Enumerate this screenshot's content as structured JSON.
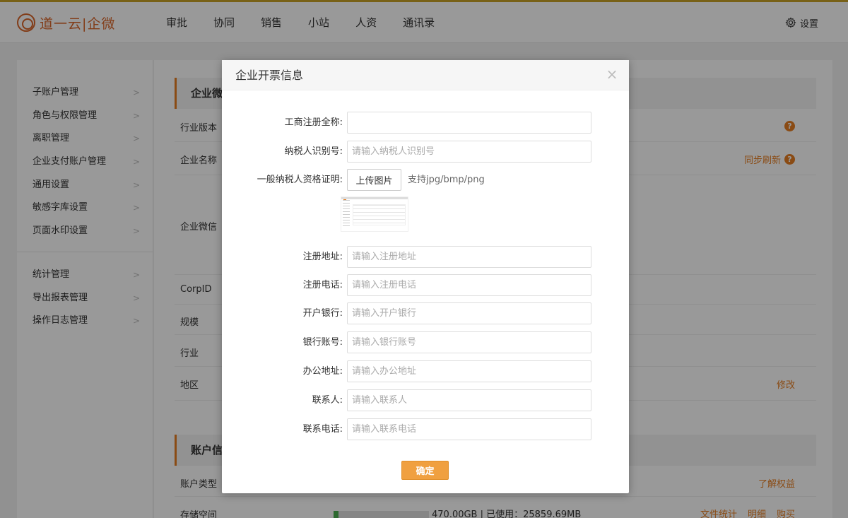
{
  "header": {
    "logo_text": "道一云|企微",
    "nav": [
      "审批",
      "协同",
      "销售",
      "小站",
      "人资",
      "通讯录"
    ],
    "settings_label": "设置"
  },
  "sidebar": {
    "group1": [
      "子账户管理",
      "角色与权限管理",
      "离职管理",
      "企业支付账户管理",
      "通用设置",
      "敏感字库设置",
      "页面水印设置"
    ],
    "group2": [
      "统计管理",
      "导出报表管理",
      "操作日志管理"
    ]
  },
  "content": {
    "section1_title": "企业微",
    "rows": {
      "industry_version": "行业版本",
      "company_name": "企业名称",
      "sync_refresh": "同步刷新",
      "wecom": "企业微信",
      "corpid": "CorpID",
      "scale": "规模",
      "industry": "行业",
      "region": "地区",
      "modify": "修改"
    },
    "section2_title": "账户信",
    "account_type": "账户类型",
    "learn_benefits": "了解权益",
    "storage_label": "存储空间",
    "storage_text": "470.00GB  | 已使用：25859.69MB",
    "storage_used_fraction": 0.055,
    "storage_links": [
      "文件统计",
      "明细",
      "购买"
    ]
  },
  "modal": {
    "title": "企业开票信息",
    "close": "×",
    "fields": {
      "company_full_name": {
        "label": "工商注册全称:",
        "value": ""
      },
      "tax_id": {
        "label": "纳税人识别号:",
        "placeholder": "请输入纳税人识别号"
      },
      "taxpayer_cert": {
        "label": "一般纳税人资格证明:",
        "button": "上传图片",
        "hint": "支持jpg/bmp/png"
      },
      "reg_address": {
        "label": "注册地址:",
        "placeholder": "请输入注册地址"
      },
      "reg_phone": {
        "label": "注册电话:",
        "placeholder": "请输入注册电话"
      },
      "bank": {
        "label": "开户银行:",
        "placeholder": "请输入开户银行"
      },
      "bank_account": {
        "label": "银行账号:",
        "placeholder": "请输入银行账号"
      },
      "office_address": {
        "label": "办公地址:",
        "placeholder": "请输入办公地址"
      },
      "contact": {
        "label": "联系人:",
        "placeholder": "请输入联系人"
      },
      "contact_phone": {
        "label": "联系电话:",
        "placeholder": "请输入联系电话"
      }
    },
    "confirm": "确定"
  },
  "colors": {
    "accent": "#e67e22",
    "button": "#f0a040",
    "storage_fill": "#4caf50"
  }
}
